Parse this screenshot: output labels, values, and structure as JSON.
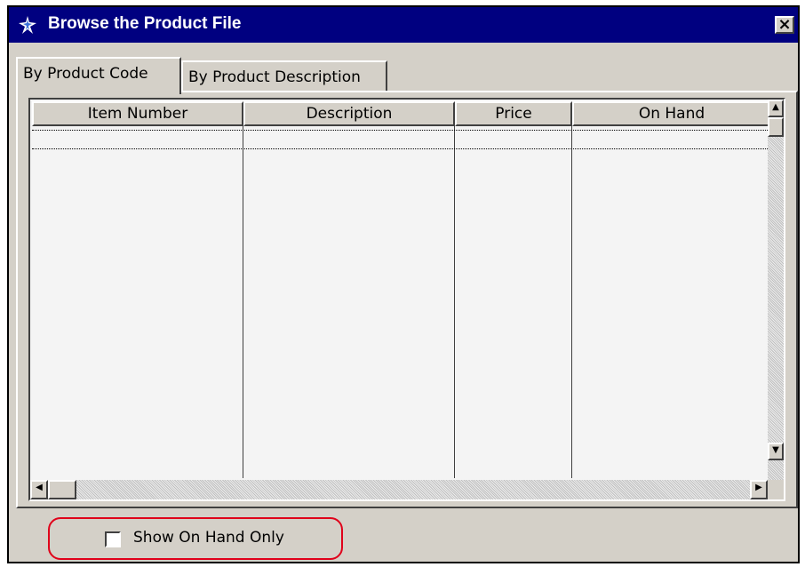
{
  "window": {
    "title": "Browse the Product File",
    "close_glyph": "×"
  },
  "tabs": [
    {
      "label": "By Product Code",
      "active": true
    },
    {
      "label": "By Product Description",
      "active": false
    }
  ],
  "table": {
    "columns": [
      "Item Number",
      "Description",
      "Price",
      "On Hand"
    ],
    "rows": []
  },
  "scroll": {
    "up": "▲",
    "left": "◀",
    "right": "▶",
    "down": "▼"
  },
  "filter": {
    "show_on_hand_label": "Show On Hand Only",
    "checked": false
  },
  "colors": {
    "titlebar": "#000080",
    "face": "#d4d0c8",
    "highlight": "#e0001a"
  }
}
